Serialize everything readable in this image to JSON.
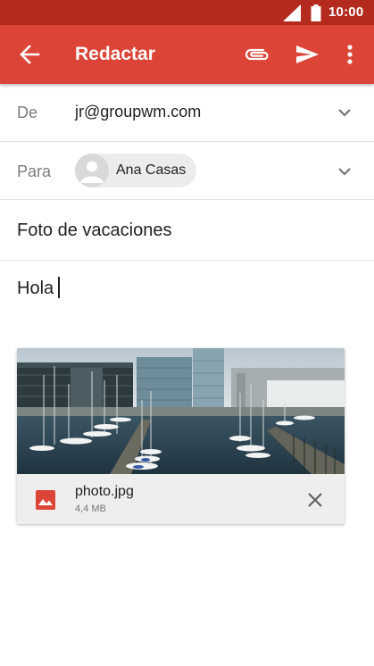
{
  "status_bar": {
    "time": "10:00",
    "icons": [
      "signal-icon",
      "battery-icon"
    ]
  },
  "app_bar": {
    "title": "Redactar",
    "icons": [
      "back-arrow-icon",
      "paperclip-icon",
      "send-icon",
      "more-vert-icon"
    ]
  },
  "compose": {
    "from_label": "De",
    "from_value": "jr@groupwm.com",
    "to_label": "Para",
    "recipients": [
      {
        "name": "Ana Casas"
      }
    ],
    "subject": "Foto de vacaciones",
    "body": "Hola"
  },
  "attachment": {
    "filename": "photo.jpg",
    "size": "4,4 MB"
  },
  "colors": {
    "status_bar": "#b52a1f",
    "app_bar": "#db4437",
    "image_icon": "#db4437"
  }
}
